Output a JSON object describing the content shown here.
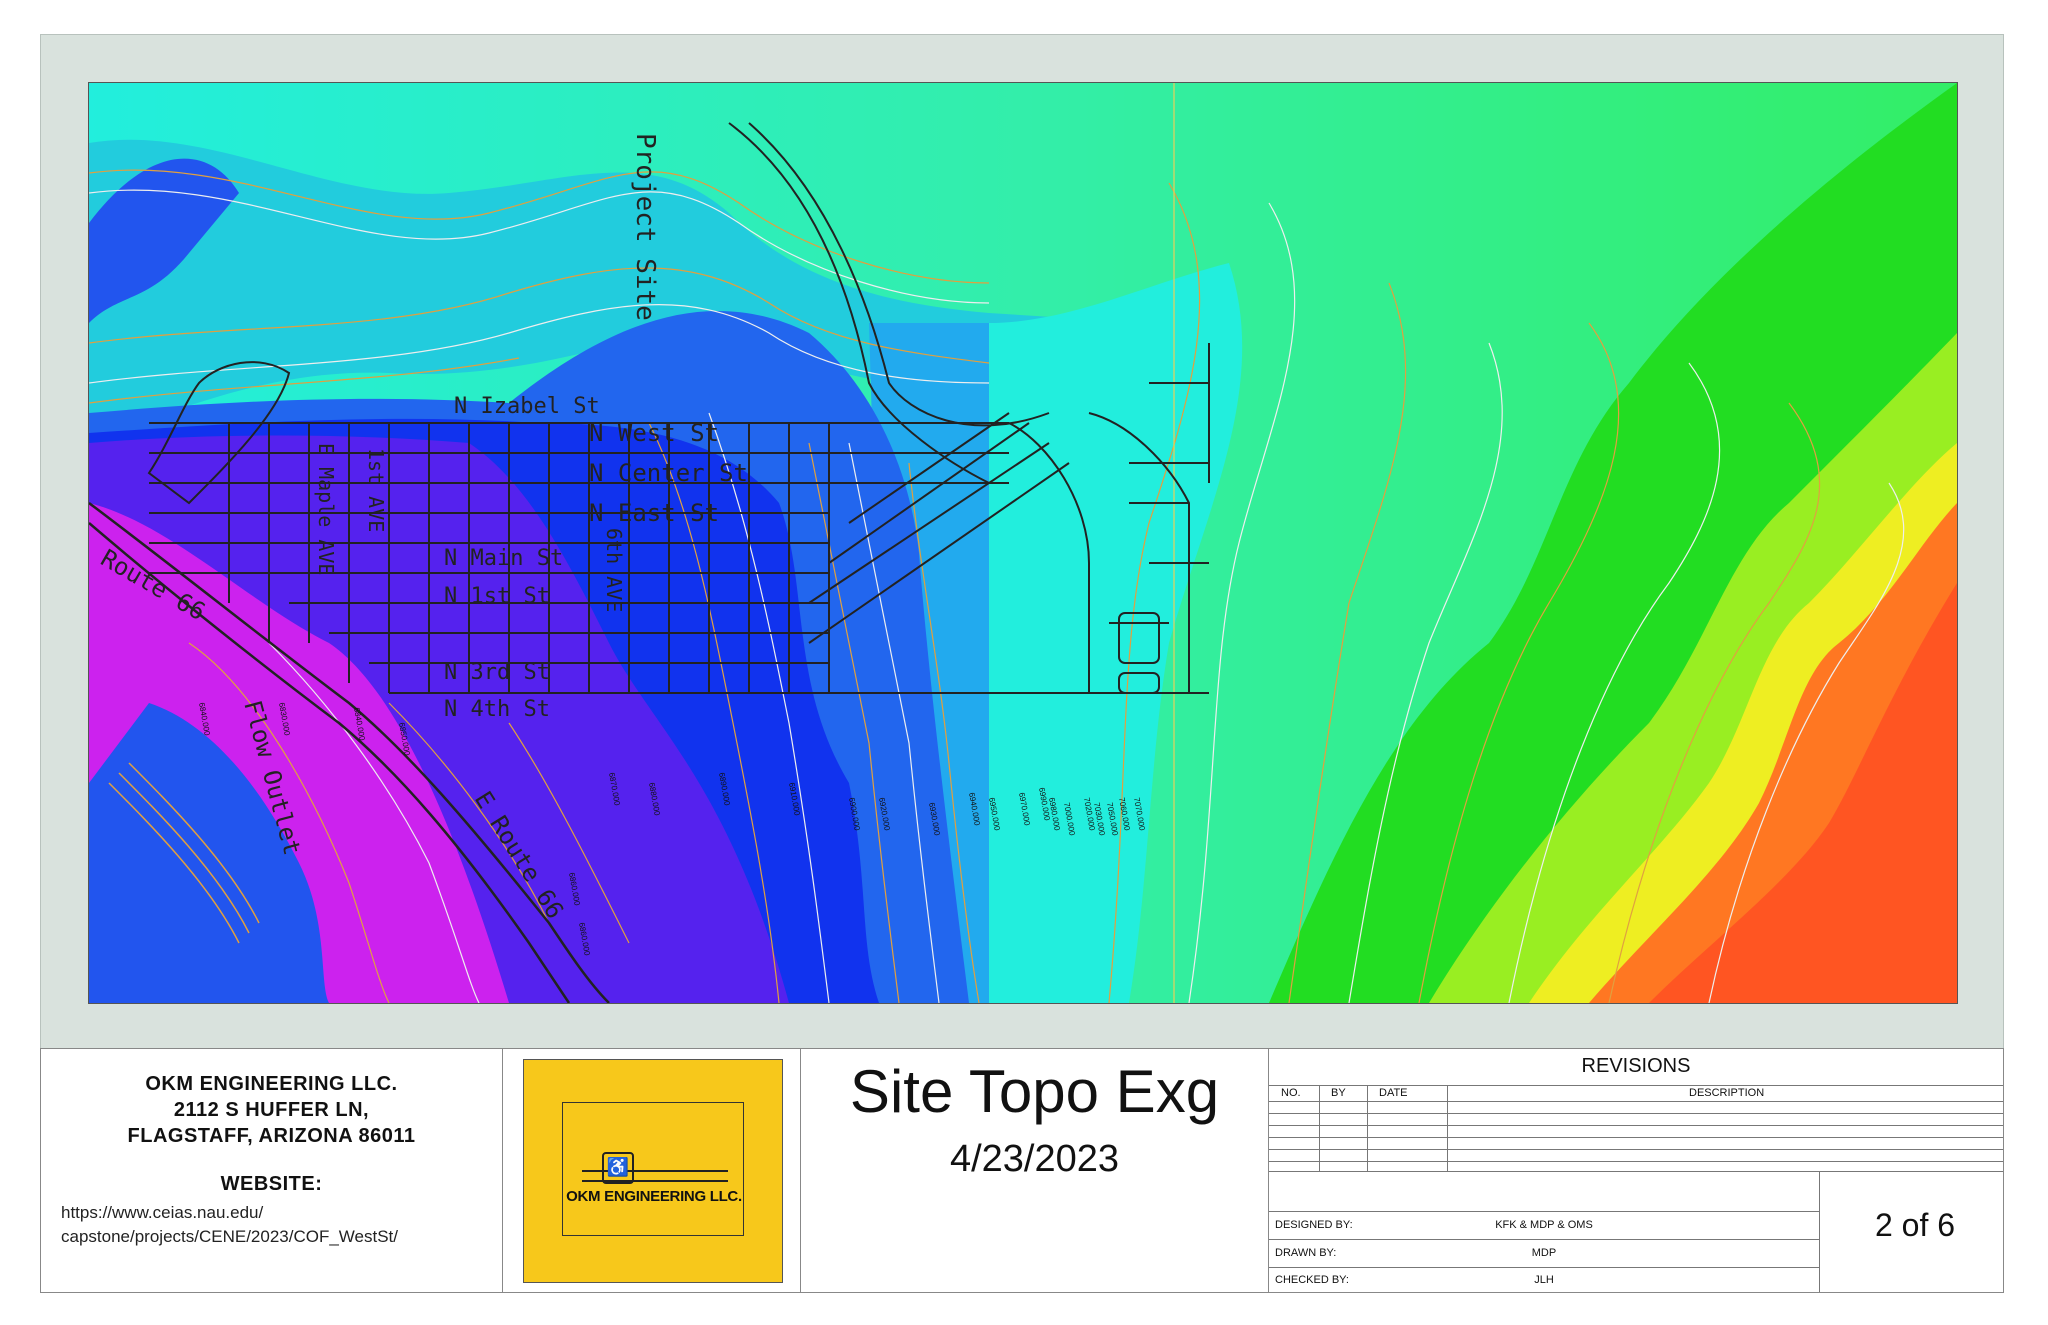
{
  "map": {
    "labels": {
      "project_site": "Project Site",
      "n_izabel_st": "N Izabel St",
      "n_west_st": "N West St",
      "n_center_st": "N Center St",
      "n_east_st": "N East St",
      "n_main_st": "N Main St",
      "n_1st_st": "N 1st St",
      "n_3rd_st": "N 3rd St",
      "n_4th_st": "N 4th St",
      "e_maple_ave": "E Maple AVE",
      "first_ave": "1st AVE",
      "sixth_ave": "6th AVE",
      "route_66": "Route 66",
      "e_route_66": "E Route 66",
      "flow_outlet": "Flow Outlet"
    },
    "contour_labels": [
      "6840.000",
      "6830.000",
      "6840.000",
      "6850.000",
      "6870.000",
      "6880.000",
      "6890.000",
      "6910.000",
      "6900.000",
      "6920.000",
      "6930.000",
      "6940.000",
      "6950.000",
      "6970.000",
      "6990.000",
      "6980.000",
      "7000.000",
      "7020.000",
      "7030.000",
      "7050.000",
      "7060.000",
      "7070.000",
      "6860.000",
      "6860.000"
    ],
    "elevation_colors": [
      "#cc22ee",
      "#7733ee",
      "#1133ee",
      "#2266ee",
      "#22aaee",
      "#22eeee",
      "#33eebb",
      "#33ee77",
      "#22dd22",
      "#99ee22",
      "#eeee22",
      "#ffbb33",
      "#ff7722",
      "#ff5522"
    ]
  },
  "titleblock": {
    "company_line1": "OKM ENGINEERING LLC.",
    "company_line2": "2112 S HUFFER LN,",
    "company_line3": "FLAGSTAFF, ARIZONA 86011",
    "website_label": "WEBSITE:",
    "website_url_1": "https://www.ceias.nau.edu/",
    "website_url_2": "capstone/projects/CENE/2023/COF_WestSt/",
    "logo_text": "OKM ENGINEERING LLC.",
    "sheet_title": "Site Topo Exg",
    "sheet_date": "4/23/2023",
    "revisions_title": "REVISIONS",
    "col_no": "NO.",
    "col_by": "BY",
    "col_date": "DATE",
    "col_desc": "DESCRIPTION",
    "designed_by_label": "DESIGNED BY:",
    "designed_by": "KFK & MDP & OMS",
    "drawn_by_label": "DRAWN BY:",
    "drawn_by": "MDP",
    "checked_by_label": "CHECKED BY:",
    "checked_by": "JLH",
    "sheet_number": "2 of 6"
  }
}
